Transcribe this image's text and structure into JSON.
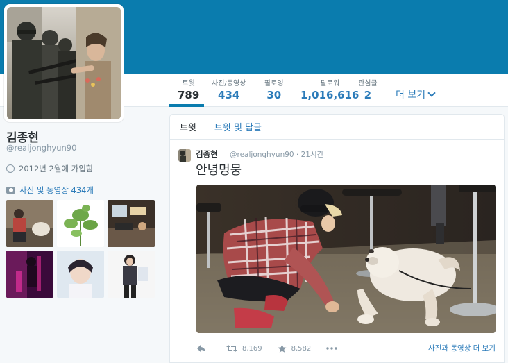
{
  "profile": {
    "name": "김종현",
    "handle": "@realjonghyun90",
    "joined": "2012년 2월에 가입함",
    "photos_link": "사진 및 동영상 434개"
  },
  "stats": [
    {
      "label": "트윗",
      "value": "789"
    },
    {
      "label": "사진/동영상",
      "value": "434"
    },
    {
      "label": "팔로잉",
      "value": "30"
    },
    {
      "label": "팔로워",
      "value": "1,016,616"
    },
    {
      "label": "관심글",
      "value": "2"
    }
  ],
  "more_label": "더 보기",
  "tabs": {
    "tweets": "트윗",
    "tweets_replies": "트윗 및 답글"
  },
  "tweet": {
    "name": "김종현",
    "handle_time": "@realjonghyun90 · 21시간",
    "text": "안녕멍뭉",
    "retweets": "8,169",
    "likes": "8,582",
    "more_media": "사진과 동영상 더 보기"
  },
  "colors": {
    "header": "#0a7cae",
    "link": "#2b7bb9",
    "muted": "#8899a6"
  }
}
